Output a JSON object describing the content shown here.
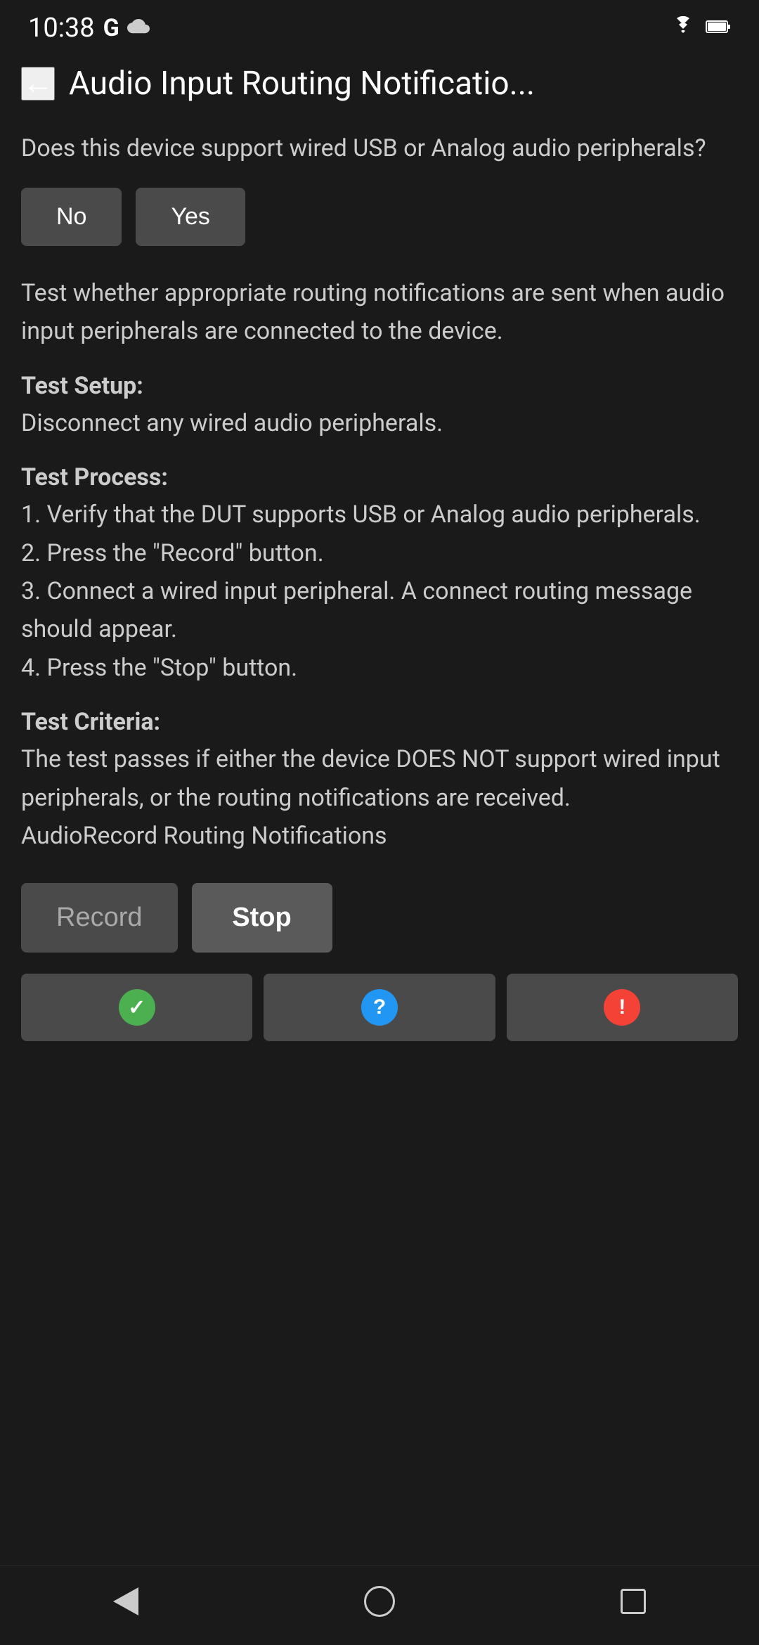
{
  "status_bar": {
    "time": "10:38",
    "g_label": "G",
    "cloud_symbol": "☁"
  },
  "header": {
    "back_label": "←",
    "title": "Audio Input Routing Notificatio..."
  },
  "question": {
    "text": "Does this device support wired USB or Analog audio peripherals?"
  },
  "yn_buttons": {
    "no_label": "No",
    "yes_label": "Yes"
  },
  "description": {
    "text": "Test whether appropriate routing notifications are sent when audio input peripherals are connected to the device."
  },
  "test_setup": {
    "label": "Test Setup:",
    "content": "Disconnect any wired audio peripherals."
  },
  "test_process": {
    "label": "Test Process:",
    "content": "1. Verify that the DUT supports USB or Analog audio peripherals.\n2. Press the \"Record\" button.\n3. Connect a wired input peripheral. A connect routing message should appear.\n4. Press the \"Stop\" button."
  },
  "test_criteria": {
    "label": "Test Criteria:",
    "content": "The test passes if either the device DOES NOT support wired input peripherals, or the routing notifications are received.\nAudioRecord Routing Notifications"
  },
  "action_buttons": {
    "record_label": "Record",
    "stop_label": "Stop"
  },
  "result_icons": {
    "pass_check": "✓",
    "question_mark": "?",
    "exclamation": "!"
  },
  "nav_bar": {
    "back_label": "back",
    "home_label": "home",
    "recent_label": "recent"
  }
}
